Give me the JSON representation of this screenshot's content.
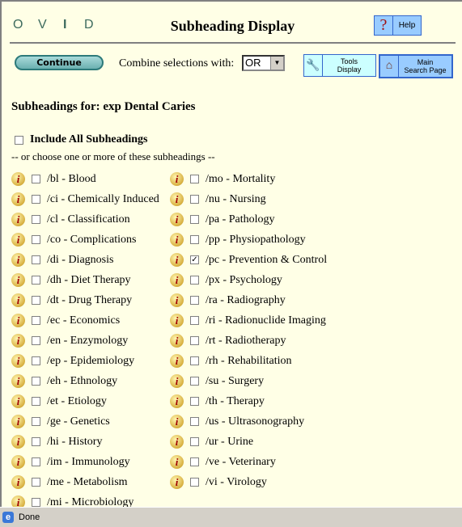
{
  "header": {
    "logo": [
      "O",
      "V",
      "I",
      "D"
    ],
    "title": "Subheading Display",
    "help_label": "Help"
  },
  "toolbar": {
    "continue_label": "Continue",
    "combine_label": "Combine selections with:",
    "combine_value": "OR",
    "tools_label": [
      "Tools",
      "Display"
    ],
    "main_label": [
      "Main",
      "Search Page"
    ]
  },
  "content": {
    "subheadings_for": "Subheadings for: exp Dental Caries",
    "include_all": "Include All Subheadings",
    "or_choose": "-- or choose one or more of these subheadings --"
  },
  "left_column": [
    {
      "label": "/bl - Blood",
      "checked": false
    },
    {
      "label": "/ci - Chemically Induced",
      "checked": false
    },
    {
      "label": "/cl - Classification",
      "checked": false
    },
    {
      "label": "/co - Complications",
      "checked": false
    },
    {
      "label": "/di - Diagnosis",
      "checked": false
    },
    {
      "label": "/dh - Diet Therapy",
      "checked": false
    },
    {
      "label": "/dt - Drug Therapy",
      "checked": false
    },
    {
      "label": "/ec - Economics",
      "checked": false
    },
    {
      "label": "/en - Enzymology",
      "checked": false
    },
    {
      "label": "/ep - Epidemiology",
      "checked": false
    },
    {
      "label": "/eh - Ethnology",
      "checked": false
    },
    {
      "label": "/et - Etiology",
      "checked": false
    },
    {
      "label": "/ge - Genetics",
      "checked": false
    },
    {
      "label": "/hi - History",
      "checked": false
    },
    {
      "label": "/im - Immunology",
      "checked": false
    },
    {
      "label": "/me - Metabolism",
      "checked": false
    },
    {
      "label": "/mi - Microbiology",
      "checked": false
    }
  ],
  "right_column": [
    {
      "label": "/mo - Mortality",
      "checked": false
    },
    {
      "label": "/nu - Nursing",
      "checked": false
    },
    {
      "label": "/pa - Pathology",
      "checked": false
    },
    {
      "label": "/pp - Physiopathology",
      "checked": false
    },
    {
      "label": "/pc - Prevention & Control",
      "checked": true
    },
    {
      "label": "/px - Psychology",
      "checked": false
    },
    {
      "label": "/ra - Radiography",
      "checked": false
    },
    {
      "label": "/ri - Radionuclide Imaging",
      "checked": false
    },
    {
      "label": "/rt - Radiotherapy",
      "checked": false
    },
    {
      "label": "/rh - Rehabilitation",
      "checked": false
    },
    {
      "label": "/su - Surgery",
      "checked": false
    },
    {
      "label": "/th - Therapy",
      "checked": false
    },
    {
      "label": "/us - Ultrasonography",
      "checked": false
    },
    {
      "label": "/ur - Urine",
      "checked": false
    },
    {
      "label": "/ve - Veterinary",
      "checked": false
    },
    {
      "label": "/vi - Virology",
      "checked": false
    }
  ],
  "status": {
    "text": "Done"
  },
  "icons": {
    "info": "info-icon",
    "help": "question-icon",
    "tools": "wrench-icon",
    "main": "house-icon"
  }
}
